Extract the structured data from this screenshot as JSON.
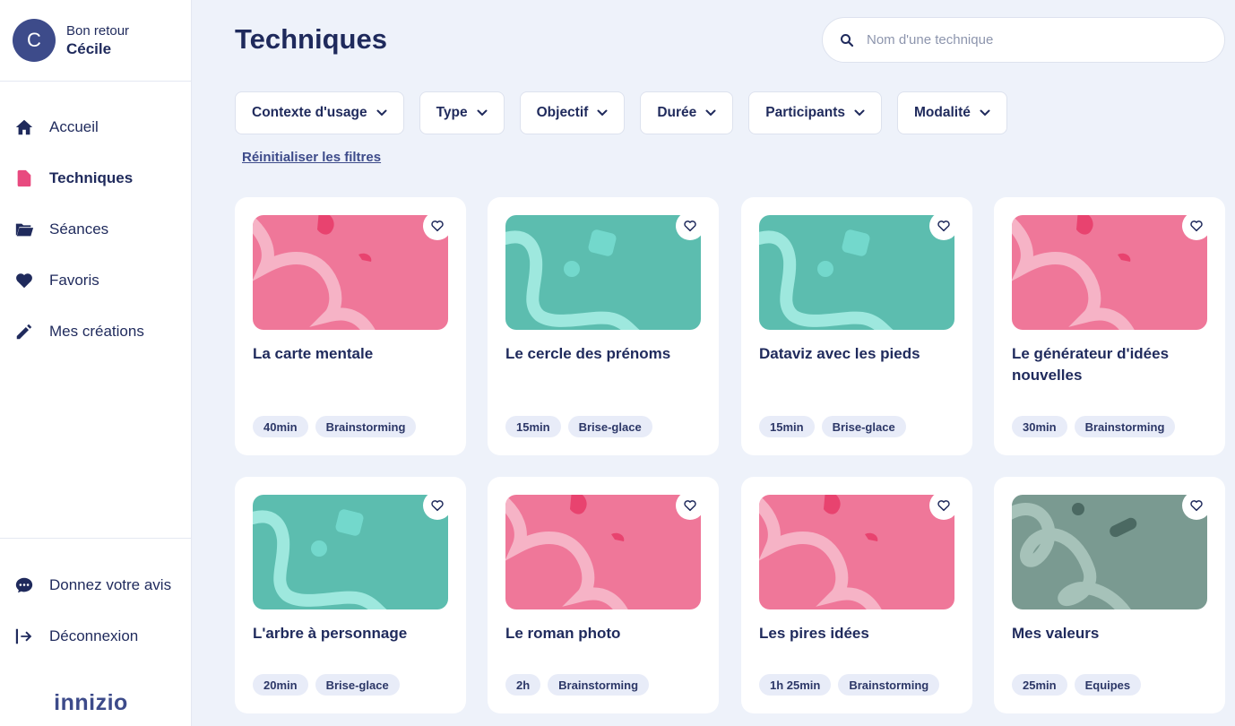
{
  "user": {
    "greeting": "Bon retour",
    "name": "Cécile",
    "initial": "C"
  },
  "nav": [
    {
      "label": "Accueil",
      "icon": "home-icon"
    },
    {
      "label": "Techniques",
      "icon": "document-icon",
      "active": true
    },
    {
      "label": "Séances",
      "icon": "folder-icon"
    },
    {
      "label": "Favoris",
      "icon": "heart-icon"
    },
    {
      "label": "Mes créations",
      "icon": "pencil-icon"
    }
  ],
  "bottom_nav": [
    {
      "label": "Donnez votre avis",
      "icon": "chat-icon"
    },
    {
      "label": "Déconnexion",
      "icon": "logout-icon"
    }
  ],
  "logo": "innizio",
  "page": {
    "title": "Techniques"
  },
  "search": {
    "placeholder": "Nom d'une technique",
    "value": ""
  },
  "filters": [
    "Contexte d'usage",
    "Type",
    "Objectif",
    "Durée",
    "Participants",
    "Modalité"
  ],
  "reset_label": "Réinitialiser les filtres",
  "colors": {
    "pink": "#ef7799",
    "teal": "#5cbdaf",
    "slate": "#7a9a91",
    "navy": "#1f2a5c",
    "accent": "#e84a7f"
  },
  "cards": [
    {
      "title": "La carte mentale",
      "duration": "40min",
      "category": "Brainstorming",
      "theme": "pink"
    },
    {
      "title": "Le cercle des prénoms",
      "duration": "15min",
      "category": "Brise-glace",
      "theme": "teal"
    },
    {
      "title": "Dataviz avec les pieds",
      "duration": "15min",
      "category": "Brise-glace",
      "theme": "teal"
    },
    {
      "title": "Le générateur d'idées nouvelles",
      "duration": "30min",
      "category": "Brainstorming",
      "theme": "pink"
    },
    {
      "title": "L'arbre à personnage",
      "duration": "20min",
      "category": "Brise-glace",
      "theme": "teal"
    },
    {
      "title": "Le roman photo",
      "duration": "2h",
      "category": "Brainstorming",
      "theme": "pink"
    },
    {
      "title": "Les pires idées",
      "duration": "1h 25min",
      "category": "Brainstorming",
      "theme": "pink"
    },
    {
      "title": "Mes valeurs",
      "duration": "25min",
      "category": "Equipes",
      "theme": "slate"
    }
  ]
}
